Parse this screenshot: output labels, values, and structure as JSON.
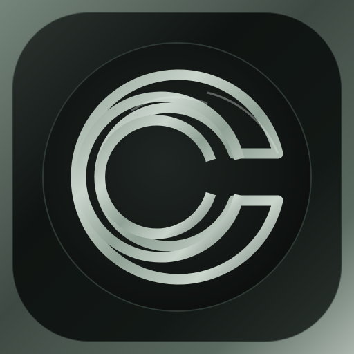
{
  "app_icon": {
    "glyph_icon": "concentric-c-logo-icon",
    "colors": {
      "background_light": "#aab5ad",
      "background_dark": "#3e4842",
      "tile_dark": "#0f1412",
      "tile_mid": "#2c3430",
      "disc_dark": "#121614",
      "glyph_light": "#c9d4cb",
      "glyph_mid": "#8fa094",
      "glyph_dark": "#5f6f65"
    }
  }
}
